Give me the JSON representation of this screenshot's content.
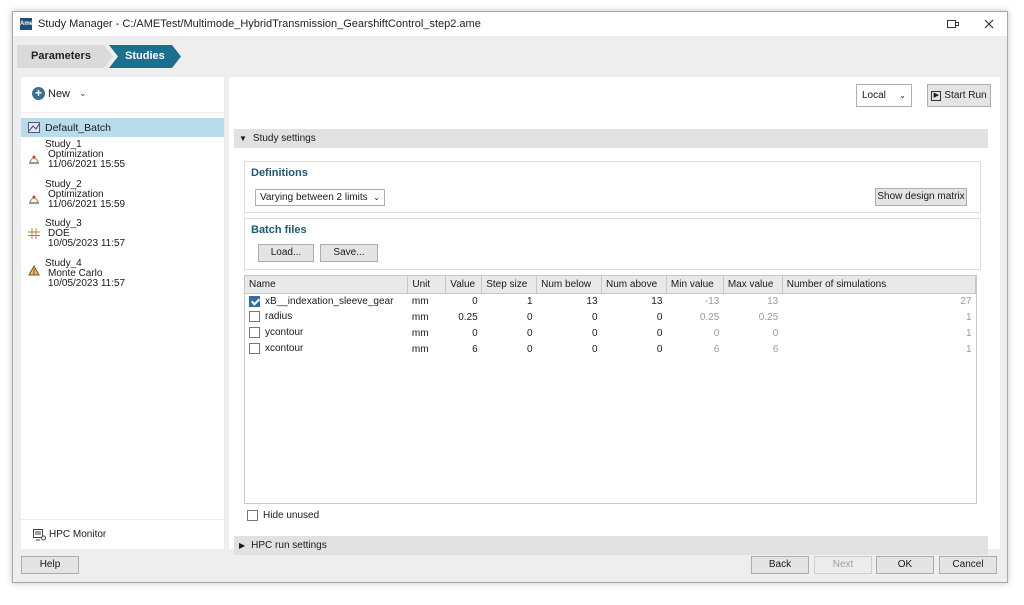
{
  "window": {
    "title": "Study Manager - C:/AMETest/Multimode_HybridTransmission_GearshiftControl_step2.ame",
    "app_icon_text": "Ame"
  },
  "breadcrumb": {
    "items": [
      "Parameters",
      "Studies"
    ]
  },
  "toolbar": {
    "new_label": "New"
  },
  "studies": [
    {
      "name": "Default_Batch",
      "selected": true,
      "icon": "batch-icon"
    },
    {
      "name": "Study_1",
      "type": "Optimization",
      "date": "11/06/2021 15:55",
      "icon": "optimization-icon"
    },
    {
      "name": "Study_2",
      "type": "Optimization",
      "date": "11/06/2021 15:59",
      "icon": "optimization-icon"
    },
    {
      "name": "Study_3",
      "type": "DOE",
      "date": "10/05/2023 11:57",
      "icon": "doe-icon"
    },
    {
      "name": "Study_4",
      "type": "Monte Carlo",
      "date": "10/05/2023 11:57",
      "icon": "monte-carlo-icon"
    }
  ],
  "hpc_monitor_label": "HPC Monitor",
  "run": {
    "location": "Local",
    "start_label": "Start Run"
  },
  "study_settings": {
    "header": "Study settings",
    "definitions_title": "Definitions",
    "definition_mode": "Varying between 2 limits",
    "show_matrix_label": "Show design matrix",
    "batch_files_title": "Batch files",
    "load_label": "Load...",
    "save_label": "Save..."
  },
  "table": {
    "columns": [
      "Name",
      "Unit",
      "Value",
      "Step size",
      "Num below",
      "Num above",
      "Min value",
      "Max value",
      "Number of simulations"
    ],
    "rows": [
      {
        "checked": true,
        "name": "xB__indexation_sleeve_gear",
        "unit": "mm",
        "value": "0",
        "step": "1",
        "below": "13",
        "above": "13",
        "min": "-13",
        "max": "13",
        "sims": "27"
      },
      {
        "checked": false,
        "name": "radius",
        "unit": "mm",
        "value": "0.25",
        "step": "0",
        "below": "0",
        "above": "0",
        "min": "0.25",
        "max": "0.25",
        "sims": "1"
      },
      {
        "checked": false,
        "name": "ycontour",
        "unit": "mm",
        "value": "0",
        "step": "0",
        "below": "0",
        "above": "0",
        "min": "0",
        "max": "0",
        "sims": "1"
      },
      {
        "checked": false,
        "name": "xcontour",
        "unit": "mm",
        "value": "6",
        "step": "0",
        "below": "0",
        "above": "0",
        "min": "6",
        "max": "6",
        "sims": "1"
      }
    ]
  },
  "hide_unused_label": "Hide unused",
  "hpc_run_settings_label": "HPC run settings",
  "footer": {
    "help": "Help",
    "back": "Back",
    "next": "Next",
    "ok": "OK",
    "cancel": "Cancel"
  }
}
